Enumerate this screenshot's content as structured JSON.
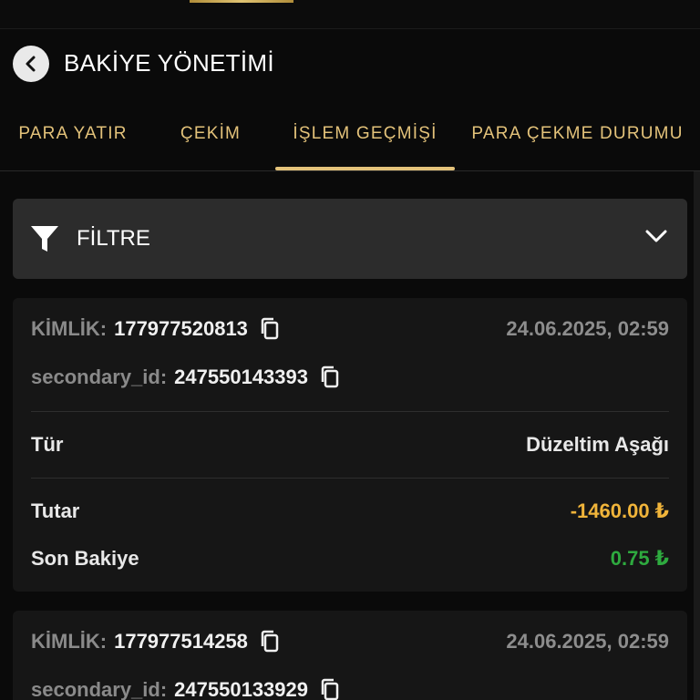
{
  "header": {
    "title": "BAKİYE YÖNETİMİ"
  },
  "tabs": [
    {
      "label": "PARA YATIR",
      "active": false
    },
    {
      "label": "ÇEKİM",
      "active": false
    },
    {
      "label": "İŞLEM GEÇMİŞİ",
      "active": true
    },
    {
      "label": "PARA ÇEKME DURUMU",
      "active": false
    }
  ],
  "filter": {
    "label": "FİLTRE"
  },
  "transactions": [
    {
      "id_label": "KİMLİK:",
      "id_value": "177977520813",
      "date": "24.06.2025, 02:59",
      "secondary_label": "secondary_id:",
      "secondary_value": "247550143393",
      "type_label": "Tür",
      "type_value": "Düzeltim Aşağı",
      "amount_label": "Tutar",
      "amount_value": "-1460.00 ₺",
      "balance_label": "Son Bakiye",
      "balance_value": "0.75 ₺"
    },
    {
      "id_label": "KİMLİK:",
      "id_value": "177977514258",
      "date": "24.06.2025, 02:59",
      "secondary_label": "secondary_id:",
      "secondary_value": "247550133929"
    }
  ],
  "colors": {
    "accent_gold": "#e3c27a",
    "amount_negative": "#f0b43a",
    "balance_positive": "#2eaa3f",
    "background": "#0a0a0a",
    "card": "#161616"
  },
  "icons": [
    "back-arrow-icon",
    "filter-icon",
    "chevron-down-icon",
    "copy-icon"
  ]
}
